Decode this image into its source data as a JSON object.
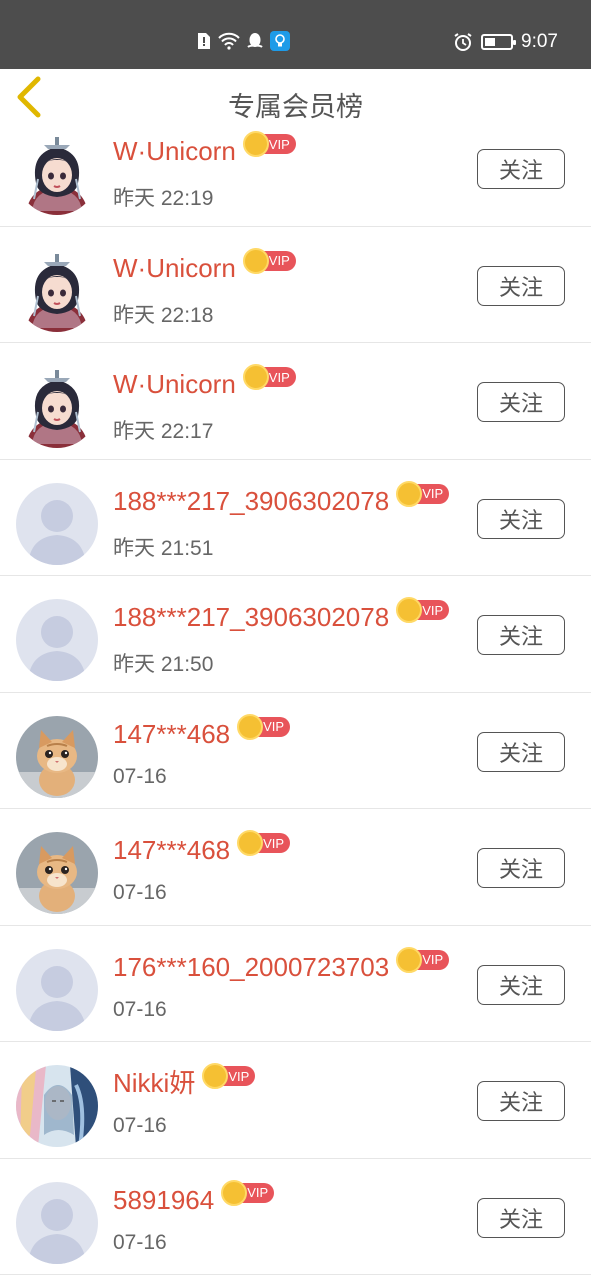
{
  "status_bar": {
    "time": "9:07",
    "icons": [
      "sim-alert-icon",
      "wifi-icon",
      "qq-icon",
      "bulb-app-icon",
      "alarm-icon",
      "battery-icon"
    ],
    "battery_level": 0.4
  },
  "header": {
    "title": "专属会员榜",
    "back_icon": "chevron-left-icon",
    "accent_color": "#e0b700"
  },
  "colors": {
    "name": "#d9503c",
    "vip_badge": "#e8545a",
    "crown": "#f5c033"
  },
  "members": [
    {
      "name": "W·Unicorn",
      "badge": "VIP",
      "time": "昨天 22:19",
      "avatar": "anime-girl",
      "follow_label": "关注"
    },
    {
      "name": "W·Unicorn",
      "badge": "VIP",
      "time": "昨天 22:18",
      "avatar": "anime-girl",
      "follow_label": "关注"
    },
    {
      "name": "W·Unicorn",
      "badge": "VIP",
      "time": "昨天 22:17",
      "avatar": "anime-girl",
      "follow_label": "关注"
    },
    {
      "name": "188***217_3906302078",
      "badge": "VIP",
      "time": "昨天 21:51",
      "avatar": "default",
      "follow_label": "关注"
    },
    {
      "name": "188***217_3906302078",
      "badge": "VIP",
      "time": "昨天 21:50",
      "avatar": "default",
      "follow_label": "关注"
    },
    {
      "name": "147***468",
      "badge": "VIP",
      "time": "07-16",
      "avatar": "kitten",
      "follow_label": "关注"
    },
    {
      "name": "147***468",
      "badge": "VIP",
      "time": "07-16",
      "avatar": "kitten",
      "follow_label": "关注"
    },
    {
      "name": "176***160_2000723703",
      "badge": "VIP",
      "time": "07-16",
      "avatar": "default",
      "follow_label": "关注"
    },
    {
      "name": "Nikki妍",
      "badge": "VIP",
      "time": "07-16",
      "avatar": "painting",
      "follow_label": "关注"
    },
    {
      "name": "5891964",
      "badge": "VIP",
      "time": "07-16",
      "avatar": "default",
      "follow_label": "关注"
    }
  ]
}
